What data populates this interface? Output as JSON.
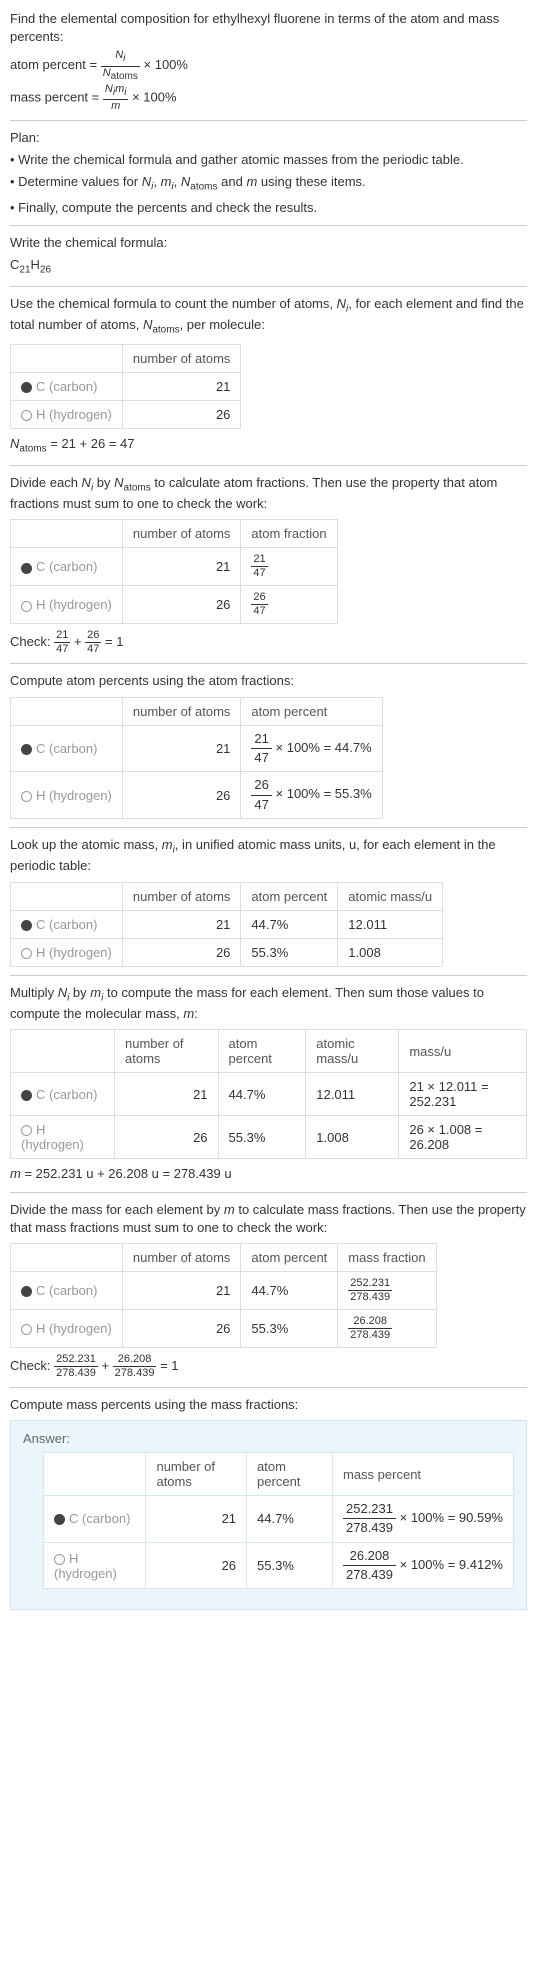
{
  "intro": {
    "line1": "Find the elemental composition for ethylhexyl fluorene in terms of the atom and mass percents:",
    "atom_percent_label": "atom percent =",
    "atom_percent_frac_num": "N_i",
    "atom_percent_frac_den": "N_atoms",
    "times_100": "× 100%",
    "mass_percent_label": "mass percent =",
    "mass_percent_frac_num": "N_i m_i",
    "mass_percent_frac_den": "m"
  },
  "plan": {
    "heading": "Plan:",
    "b1": "• Write the chemical formula and gather atomic masses from the periodic table.",
    "b2_a": "• Determine values for ",
    "b2_b": " using these items.",
    "b2_vars": "N_i, m_i, N_atoms and m",
    "b3": "• Finally, compute the percents and check the results."
  },
  "step1": {
    "heading": "Write the chemical formula:",
    "formula_c": "C",
    "formula_c_sub": "21",
    "formula_h": "H",
    "formula_h_sub": "26"
  },
  "step2": {
    "text_a": "Use the chemical formula to count the number of atoms, ",
    "text_ni": "N_i",
    "text_b": ", for each element and find the total number of atoms, ",
    "text_natoms": "N_atoms",
    "text_c": ", per molecule:",
    "col_atoms": "number of atoms",
    "carbon_name": "C (carbon)",
    "carbon_atoms": "21",
    "hydrogen_name": "H (hydrogen)",
    "hydrogen_atoms": "26",
    "sum_line": "N_atoms = 21 + 26 = 47"
  },
  "step3": {
    "text_a": "Divide each ",
    "ni": "N_i",
    "text_b": " by ",
    "natoms": "N_atoms",
    "text_c": " to calculate atom fractions. Then use the property that atom fractions must sum to one to check the work:",
    "col_atoms": "number of atoms",
    "col_frac": "atom fraction",
    "carbon_name": "C (carbon)",
    "carbon_atoms": "21",
    "carbon_frac_num": "21",
    "carbon_frac_den": "47",
    "hydrogen_name": "H (hydrogen)",
    "hydrogen_atoms": "26",
    "hydrogen_frac_num": "26",
    "hydrogen_frac_den": "47",
    "check_label": "Check: ",
    "check_eq": " = 1"
  },
  "step4": {
    "heading": "Compute atom percents using the atom fractions:",
    "col_atoms": "number of atoms",
    "col_pct": "atom percent",
    "carbon_name": "C (carbon)",
    "carbon_atoms": "21",
    "carbon_num": "21",
    "carbon_den": "47",
    "carbon_res": "× 100% = 44.7%",
    "hydrogen_name": "H (hydrogen)",
    "hydrogen_atoms": "26",
    "hydrogen_num": "26",
    "hydrogen_den": "47",
    "hydrogen_res": "× 100% = 55.3%"
  },
  "step5": {
    "text_a": "Look up the atomic mass, ",
    "mi": "m_i",
    "text_b": ", in unified atomic mass units, u, for each element in the periodic table:",
    "col_atoms": "number of atoms",
    "col_pct": "atom percent",
    "col_mass": "atomic mass/u",
    "carbon_name": "C (carbon)",
    "carbon_atoms": "21",
    "carbon_pct": "44.7%",
    "carbon_mass": "12.011",
    "hydrogen_name": "H (hydrogen)",
    "hydrogen_atoms": "26",
    "hydrogen_pct": "55.3%",
    "hydrogen_mass": "1.008"
  },
  "step6": {
    "text_a": "Multiply ",
    "ni": "N_i",
    "text_b": " by ",
    "mi": "m_i",
    "text_c": " to compute the mass for each element. Then sum those values to compute the molecular mass, ",
    "m": "m",
    "text_d": ":",
    "col_atoms": "number of atoms",
    "col_pct": "atom percent",
    "col_amass": "atomic mass/u",
    "col_mass": "mass/u",
    "carbon_name": "C (carbon)",
    "carbon_atoms": "21",
    "carbon_pct": "44.7%",
    "carbon_amass": "12.011",
    "carbon_mass": "21 × 12.011 = 252.231",
    "hydrogen_name": "H (hydrogen)",
    "hydrogen_atoms": "26",
    "hydrogen_pct": "55.3%",
    "hydrogen_amass": "1.008",
    "hydrogen_mass": "26 × 1.008 = 26.208",
    "sum_line": "m = 252.231 u + 26.208 u = 278.439 u"
  },
  "step7": {
    "text_a": "Divide the mass for each element by ",
    "m": "m",
    "text_b": " to calculate mass fractions. Then use the property that mass fractions must sum to one to check the work:",
    "col_atoms": "number of atoms",
    "col_pct": "atom percent",
    "col_mfrac": "mass fraction",
    "carbon_name": "C (carbon)",
    "carbon_atoms": "21",
    "carbon_pct": "44.7%",
    "carbon_num": "252.231",
    "carbon_den": "278.439",
    "hydrogen_name": "H (hydrogen)",
    "hydrogen_atoms": "26",
    "hydrogen_pct": "55.3%",
    "hydrogen_num": "26.208",
    "hydrogen_den": "278.439",
    "check_label": "Check: ",
    "check_eq": " = 1"
  },
  "step8": {
    "heading": "Compute mass percents using the mass fractions:"
  },
  "answer": {
    "label": "Answer:",
    "col_atoms": "number of atoms",
    "col_pct": "atom percent",
    "col_mpct": "mass percent",
    "carbon_name": "C (carbon)",
    "carbon_atoms": "21",
    "carbon_pct": "44.7%",
    "carbon_num": "252.231",
    "carbon_den": "278.439",
    "carbon_res": "× 100% = 90.59%",
    "hydrogen_name": "H (hydrogen)",
    "hydrogen_atoms": "26",
    "hydrogen_pct": "55.3%",
    "hydrogen_num": "26.208",
    "hydrogen_den": "278.439",
    "hydrogen_res": "× 100% = 9.412%"
  },
  "chart_data": {
    "type": "table",
    "title": "Elemental composition of ethylhexyl fluorene (C21H26)",
    "N_atoms": 47,
    "molecular_mass_u": 278.439,
    "elements": [
      {
        "symbol": "C",
        "name": "carbon",
        "atoms": 21,
        "atom_fraction": 0.4468,
        "atom_percent": 44.7,
        "atomic_mass_u": 12.011,
        "mass_u": 252.231,
        "mass_fraction": 0.9059,
        "mass_percent": 90.59
      },
      {
        "symbol": "H",
        "name": "hydrogen",
        "atoms": 26,
        "atom_fraction": 0.5532,
        "atom_percent": 55.3,
        "atomic_mass_u": 1.008,
        "mass_u": 26.208,
        "mass_fraction": 0.09412,
        "mass_percent": 9.412
      }
    ]
  }
}
